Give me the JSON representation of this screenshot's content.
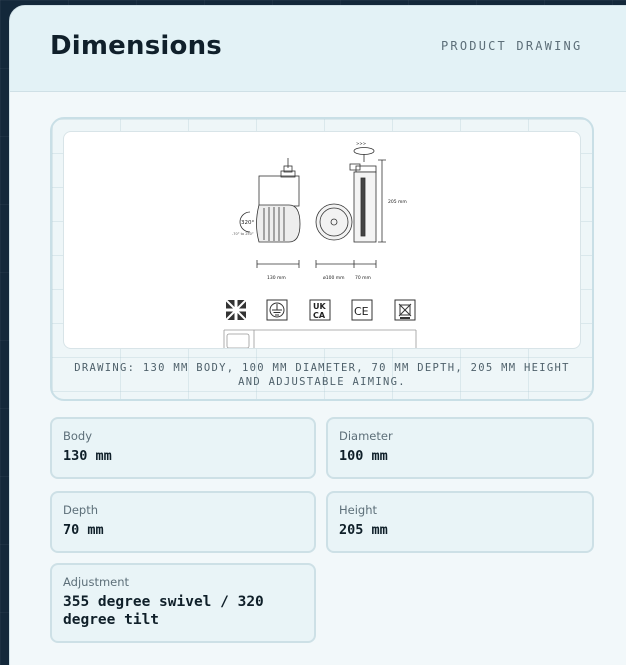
{
  "header": {
    "title": "Dimensions",
    "eyebrow": "PRODUCT DRAWING"
  },
  "drawing": {
    "caption": "DRAWING: 130 MM BODY, 100 MM DIAMETER, 70 MM DEPTH, 205 MM HEIGHT AND ADJUSTABLE AIMING.",
    "labels": {
      "body_width": "130 mm",
      "diameter": "ø100 mm",
      "depth": "70 mm",
      "height": "205 mm",
      "tilt": "320°",
      "tilt_range": "-70° to 250°",
      "swivel": ">>>"
    },
    "marks": {
      "ukca_top": "UK",
      "ukca_bottom": "CA",
      "ce": "CE"
    }
  },
  "specs": [
    {
      "label": "Body",
      "value": "130 mm"
    },
    {
      "label": "Diameter",
      "value": "100 mm"
    },
    {
      "label": "Depth",
      "value": "70 mm"
    },
    {
      "label": "Height",
      "value": "205 mm"
    },
    {
      "label": "Adjustment",
      "value": "355 degree swivel / 320 degree tilt"
    }
  ]
}
